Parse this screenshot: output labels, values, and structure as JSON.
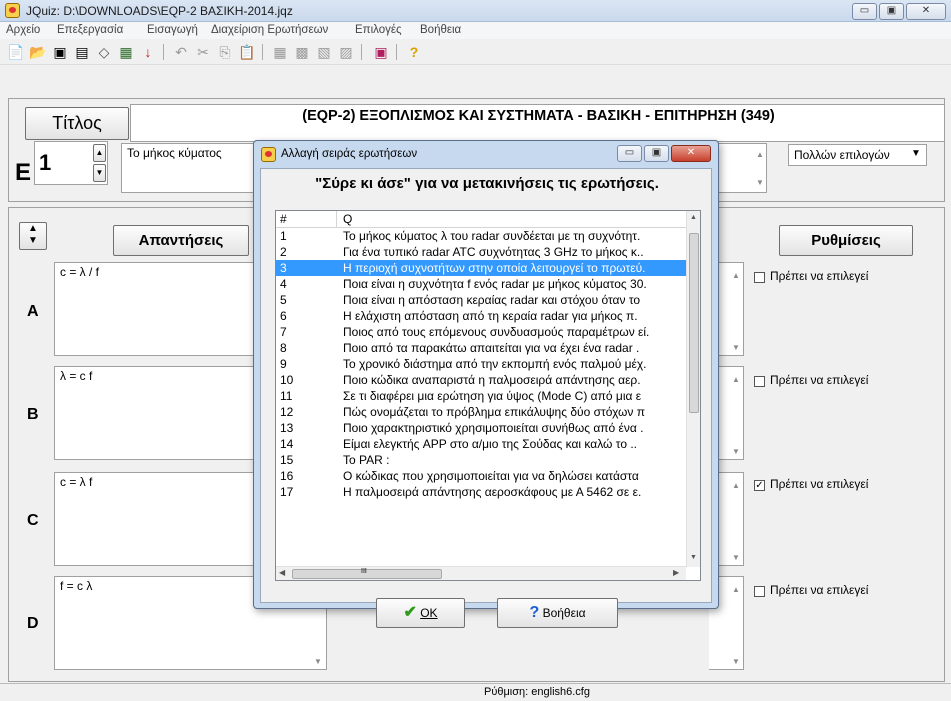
{
  "window": {
    "title": "JQuiz: D:\\DOWNLOADS\\EQP-2 ΒΑΣΙΚΗ-2014.jqz",
    "minimize": "▭",
    "maximize": "▣",
    "close": "✕"
  },
  "menu": [
    "Αρχείο",
    "Επεξεργασία",
    "Εισαγωγή",
    "Διαχείριση Ερωτήσεων",
    "Επιλογές",
    "Βοήθεια"
  ],
  "toolbar": {
    "icons": [
      "new-file",
      "open-folder",
      "save-disk",
      "save-as-disk",
      "eraser",
      "grid",
      "arrow-down",
      "undo",
      "cut",
      "copy",
      "paste",
      "tool-1",
      "tool-2",
      "tool-3",
      "tool-4",
      "export",
      "help"
    ]
  },
  "header": {
    "title_label": "Τίτλος",
    "title_value": "(EQP-2) ΕΞΟΠΛΙΣΜΟΣ ΚΑΙ ΣΥΣΤΗΜΑΤΑ - ΒΑΣΙΚΗ - ΕΠΙΤΗΡΗΣΗ (349)",
    "question_letter": "E",
    "question_number": "1",
    "question_text": "Το μήκος κύματος",
    "question_type": "Πολλών επιλογών"
  },
  "answers": {
    "header_label": "Απαντήσεις",
    "settings_label": "Ρυθμίσεις",
    "items": [
      {
        "letter": "A",
        "text": "c = λ / f",
        "setting": "Πρέπει να επιλεγεί",
        "checked": false
      },
      {
        "letter": "B",
        "text": "λ = c f",
        "setting": "Πρέπει να επιλεγεί",
        "checked": false
      },
      {
        "letter": "C",
        "text": "c = λ f",
        "setting": "Πρέπει να επιλεγεί",
        "checked": true
      },
      {
        "letter": "D",
        "text": "f = c λ",
        "setting": "Πρέπει να επιλεγεί",
        "checked": false
      }
    ]
  },
  "status": {
    "text": "Ρύθμιση: english6.cfg"
  },
  "dialog": {
    "title": "Αλλαγή σειράς ερωτήσεων",
    "heading": "\"Σύρε κι άσε\" για να μετακινήσεις τις ερωτήσεις.",
    "col_num": "#",
    "col_q": "Q",
    "selected_index": 2,
    "rows": [
      {
        "num": "1",
        "q": "Το μήκος κύματος  λ του radar συνδέεται με τη συχνότητ."
      },
      {
        "num": "2",
        "q": "Για ένα τυπικό radar ATC συχνότητας 3 GHz το μήκος κ.."
      },
      {
        "num": "3",
        "q": "Η περιοχή συχνοτήτων στην οποία λειτουργεί το πρωτεύ."
      },
      {
        "num": "4",
        "q": "Ποια είναι η συχνότητα f ενός radar με μήκος κύματος 30."
      },
      {
        "num": "5",
        "q": "Ποια είναι η απόσταση κεραίας radar και στόχου όταν το"
      },
      {
        "num": "6",
        "q": "Η ελάχιστη απόσταση από τη κεραία radar για μήκος π."
      },
      {
        "num": "7",
        "q": "Ποιος από τους επόμενους συνδυασμούς παραμέτρων εί."
      },
      {
        "num": "8",
        "q": "Ποιο από τα παρακάτω απαιτείται για να έχει ένα radar ."
      },
      {
        "num": "9",
        "q": "Το χρονικό διάστημα από την εκπομπή ενός παλμού μέχ."
      },
      {
        "num": "10",
        "q": "Ποιο κώδικα αναπαριστά η παλμοσειρά απάντησης αερ."
      },
      {
        "num": "11",
        "q": "Σε τι διαφέρει μια ερώτηση για ύψος (Mode C) από μια ε"
      },
      {
        "num": "12",
        "q": "Πώς ονομάζεται το πρόβλημα επικάλυψης δύο στόχων π"
      },
      {
        "num": "13",
        "q": "Ποιο χαρακτηριστικό χρησιμοποιείται συνήθως από ένα ."
      },
      {
        "num": "14",
        "q": "Είμαι ελεγκτής APP στο α/μιο της Σούδας και καλώ το .."
      },
      {
        "num": "15",
        "q": "Το PAR :"
      },
      {
        "num": "16",
        "q": "Ο κώδικας που χρησιμοποιείται για να δηλώσει κατάστα"
      },
      {
        "num": "17",
        "q": "Η παλμοσειρά απάντησης αεροσκάφους με Α 5462 σε ε."
      }
    ],
    "hscroll_grip": "III",
    "ok_label": "OK",
    "help_label": "Βοήθεια",
    "colors": {
      "selection": "#3399ff",
      "ok_check": "#2e9a1a",
      "help_q": "#1b5fd1"
    }
  }
}
